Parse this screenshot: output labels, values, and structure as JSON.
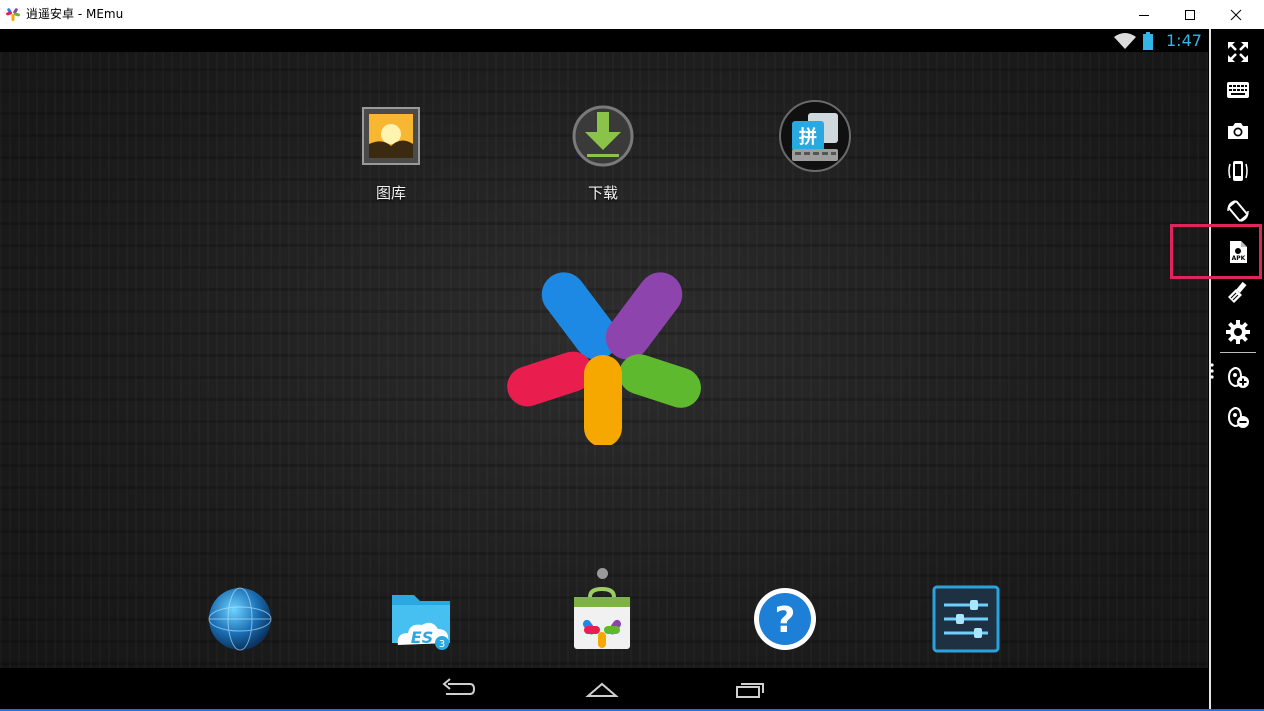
{
  "window": {
    "title": "逍遥安卓 - MEmu",
    "controls": [
      "minimize-icon",
      "maximize-icon",
      "close-icon"
    ]
  },
  "status_bar": {
    "time": "1:47",
    "icons": [
      "wifi-icon",
      "battery-icon"
    ],
    "accent_color": "#33b5e5"
  },
  "home_screen": {
    "apps": [
      {
        "label": "图库",
        "icon": "gallery-icon"
      },
      {
        "label": "下载",
        "icon": "download-icon"
      },
      {
        "label": "",
        "icon": "pinyin-input-icon"
      }
    ],
    "center_logo": "memu-logo",
    "page_indicator": {
      "count": 1,
      "current": 1
    }
  },
  "dock": {
    "apps": [
      "browser-globe-icon",
      "es-file-explorer-icon",
      "app-store-icon",
      "help-icon",
      "settings-sliders-icon"
    ]
  },
  "nav_bar": {
    "buttons": [
      "back-icon",
      "home-icon",
      "recent-apps-icon"
    ]
  },
  "sidebar": {
    "tools": [
      "fullscreen-icon",
      "keyboard-icon",
      "camera-icon",
      "shake-icon",
      "rotate-icon",
      "apk-install-icon",
      "clean-brush-icon",
      "gear-icon",
      "volume-up-icon",
      "volume-down-icon"
    ],
    "apk_badge_text": "APK",
    "highlighted_tool": "apk-install-icon",
    "highlight_color": "#e0245e"
  }
}
